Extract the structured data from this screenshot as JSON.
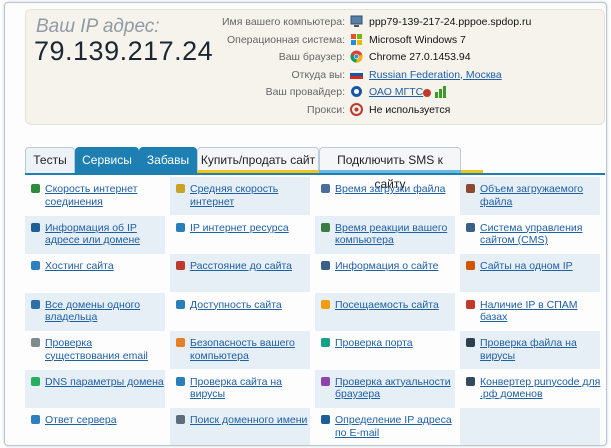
{
  "ip_block": {
    "title": "Ваш IP адрес:",
    "address": "79.139.217.24"
  },
  "info": [
    {
      "label": "Имя вашего компьютера:",
      "value": "ppp79-139-217-24.pppoe.spdop.ru",
      "icon": "computer-icon",
      "link": false
    },
    {
      "label": "Операционная система:",
      "value": "Microsoft Windows 7",
      "icon": "windows-icon",
      "link": false
    },
    {
      "label": "Ваш браузер:",
      "value": "Chrome 27.0.1453.94",
      "icon": "chrome-icon",
      "link": false
    },
    {
      "label": "Откуда вы:",
      "value": "Russian Federation, Москва",
      "icon": "russia-flag-icon",
      "link": true
    },
    {
      "label": "Ваш провайдер:",
      "value": "ОАО МГТС",
      "icon": "provider-icon",
      "link": true
    },
    {
      "label": "Прокси:",
      "value": "Не используется",
      "icon": "proxy-icon",
      "link": false
    }
  ],
  "tabs": {
    "tests": "Тесты",
    "services": "Сервисы",
    "fun": "Забавы",
    "buy_sell": "Купить/продать сайт",
    "sms": "Подключить SMS к сайту"
  },
  "services": [
    {
      "label": "Скорость интернет соединения",
      "icon": "speed-arrow-icon"
    },
    {
      "label": "Средняя скорость интернет",
      "icon": "bars-icon"
    },
    {
      "label": "Время загрузки файла",
      "icon": "clock-icon"
    },
    {
      "label": "Объем загружаемого файла",
      "icon": "file-size-icon"
    },
    {
      "label": "Информация об IP адресе или домене",
      "icon": "ip-icon"
    },
    {
      "label": "IP интернет ресурса",
      "icon": "globe-icon"
    },
    {
      "label": "Время реакции вашего компьютера",
      "icon": "reaction-icon"
    },
    {
      "label": "Система управления сайтом (CMS)",
      "icon": "cms-icon"
    },
    {
      "label": "Хостинг сайта",
      "icon": "hosting-icon"
    },
    {
      "label": "Расстояние до сайта",
      "icon": "pin-icon"
    },
    {
      "label": "Информация о сайте",
      "icon": "info-page-icon"
    },
    {
      "label": "Сайты на одном IP",
      "icon": "network-icon"
    },
    {
      "label": "Все домены одного владельца",
      "icon": "domains-icon"
    },
    {
      "label": "Доступность сайта",
      "icon": "availability-icon"
    },
    {
      "label": "Посещаемость сайта",
      "icon": "star-icon"
    },
    {
      "label": "Наличие IP в СПАМ базах",
      "icon": "spam-icon"
    },
    {
      "label": "Проверка существования email",
      "icon": "email-icon"
    },
    {
      "label": "Безопасность вашего компьютера",
      "icon": "lock-icon"
    },
    {
      "label": "Проверка порта",
      "icon": "port-icon"
    },
    {
      "label": "Проверка файла на вирусы",
      "icon": "file-virus-icon"
    },
    {
      "label": "DNS параметры домена",
      "icon": "dns-icon"
    },
    {
      "label": "Проверка сайта на вирусы",
      "icon": "site-virus-icon"
    },
    {
      "label": "Проверка актуальности браузера",
      "icon": "browser-check-icon"
    },
    {
      "label": "Конвертер punycode для .рф доменов",
      "icon": "converter-icon"
    },
    {
      "label": "Ответ сервера",
      "icon": "server-response-icon"
    },
    {
      "label": "Поиск доменного имени",
      "icon": "domain-search-icon"
    },
    {
      "label": "Определение IP адреса по E-mail",
      "icon": "email-ip-icon"
    }
  ],
  "colors": {
    "accent": "#1e7fb3",
    "link": "#1f5fa6",
    "highlight": "#f2c318",
    "shade": "#e6eff5"
  }
}
